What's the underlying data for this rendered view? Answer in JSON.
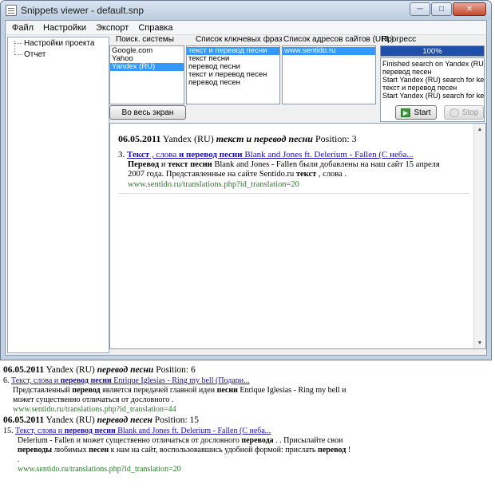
{
  "window": {
    "title": "Snippets viewer - default.snp",
    "min_label": "─",
    "max_label": "□",
    "close_label": "✕"
  },
  "menu": [
    "Файл",
    "Настройки",
    "Экспорт",
    "Справка"
  ],
  "tree": [
    "Настройки проекта",
    "Отчет"
  ],
  "panels": {
    "engines_label": "Поиск. системы",
    "phrases_label": "Список ключевых фраз",
    "sites_label": "Список адресов сайтов (URL)",
    "progress_label": "Прогресс"
  },
  "engines": [
    {
      "label": "Google.com",
      "selected": false
    },
    {
      "label": "Yahoo",
      "selected": false
    },
    {
      "label": "Yandex (RU)",
      "selected": true
    }
  ],
  "phrases": [
    {
      "label": "текст и перевод песни",
      "selected": true
    },
    {
      "label": "текст песни",
      "selected": false
    },
    {
      "label": "перевод песни",
      "selected": false
    },
    {
      "label": "текст и перевод песен",
      "selected": false
    },
    {
      "label": "перевод песен",
      "selected": false
    }
  ],
  "sites": [
    {
      "label": "www.sentido.ru",
      "selected": true
    }
  ],
  "progress": {
    "value": 1.0,
    "label": "100%"
  },
  "log": [
    "Finished search on Yandex (RU)",
    "перевод песен",
    "Start Yandex (RU) search for keyw",
    "текст и перевод песен",
    "Start Yandex (RU) search for keyw"
  ],
  "buttons": {
    "fullscreen": "Во весь экран",
    "start": "Start",
    "stop": "Stop"
  },
  "results_pane": {
    "date": "06.05.2011",
    "engine": "Yandex (RU)",
    "phrase": "текст и перевод песни",
    "position_label": "Position:",
    "position": "3",
    "index": "3.",
    "link_a": "Текст",
    "link_b": " , слова ",
    "link_c": "и перевод песни",
    "link_d": " Blank and Jones ft. Delerium - Fallen (С неба...",
    "snip1_b1": "Перевод",
    "snip1_t1": " и ",
    "snip1_b2": "текст песни",
    "snip1_t2": " Blank and Jones - Fallen были добавлены на наш сайт 15 апреля 2007 года. Представленные на сайте Sentido.ru ",
    "snip1_b3": "текст",
    "snip1_t3": " , слова .",
    "url": "www.sentido.ru/translations.php?id_translation=20"
  },
  "lower_results": [
    {
      "date": "06.05.2011",
      "engine": "Yandex (RU)",
      "phrase": "перевод песни",
      "position_label": "Position:",
      "position": "6",
      "index": "6.",
      "link_a": "Текст, слова и ",
      "link_b": "перевод песни",
      "link_c": " Enrique Iglesias - Ring my bell (Подари...",
      "s1": "Представленный ",
      "s1b": "перевод",
      "s2": " является передачей главной идеи ",
      "s2b": "песни",
      "s3": " Enrique Iglesias - Ring my bell и может существенно отличаться от дословного .",
      "url": "www.sentido.ru/translations.php?id_translation=44"
    },
    {
      "date": "06.05.2011",
      "engine": "Yandex (RU)",
      "phrase": "перевод песен",
      "position_label": "Position:",
      "position": "15",
      "index": "15.",
      "link_a": "Текст, слова и ",
      "link_b": "перевод песни",
      "link_c": " Blank and Jones ft. Delerium - Fallen (С неба...",
      "s1": "Delerium - Fallen и может существенно отличаться от дословного ",
      "s1b": "перевода",
      "s2": " . . Присылайте свои ",
      "s2b": "переводы",
      "s3": " любимых ",
      "s3b": "песен",
      "s4": " к нам на сайт, воспользовавшись удобной формой: прислать ",
      "s4b": "перевод",
      "s5": " ! .",
      "url": "www.sentido.ru/translations.php?id_translation=20"
    }
  ]
}
